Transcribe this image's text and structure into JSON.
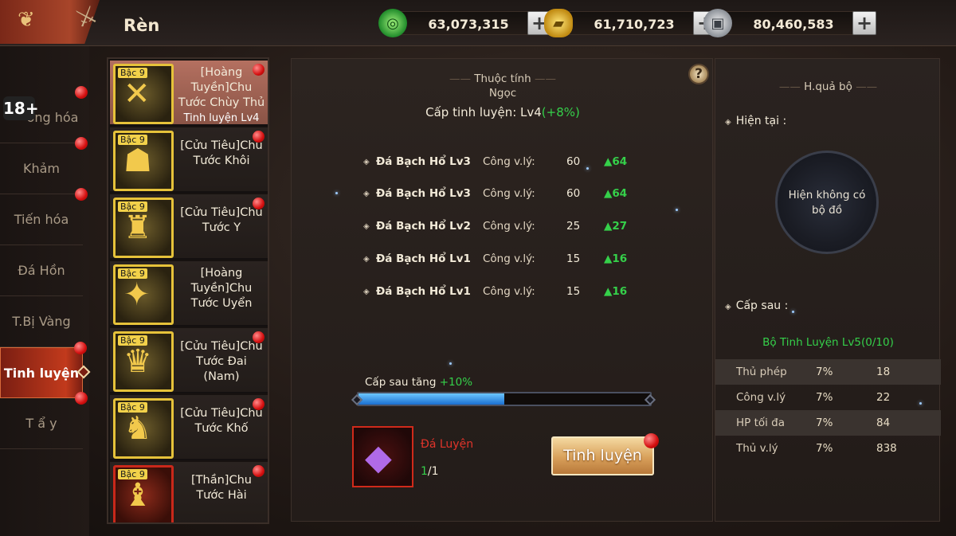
{
  "header": {
    "title": "Rèn",
    "currencies": [
      {
        "icon": "jade-coin-icon",
        "value": "63,073,315"
      },
      {
        "icon": "gold-ingot-icon",
        "value": "61,710,723"
      },
      {
        "icon": "silver-coin-icon",
        "value": "80,460,583"
      }
    ],
    "plus_label": "+"
  },
  "age_rating": "18+",
  "nav": {
    "items": [
      {
        "label": "Cường hóa",
        "badge": true
      },
      {
        "label": "Khảm",
        "badge": true
      },
      {
        "label": "Tiến hóa",
        "badge": true
      },
      {
        "label": "Đá Hồn",
        "badge": false
      },
      {
        "label": "T.Bị Vàng",
        "badge": false
      },
      {
        "label": "Tinh luyện",
        "badge": true,
        "active": true
      },
      {
        "label": "T ẩ y",
        "badge": true
      }
    ],
    "first_visible": "ờng hóa"
  },
  "items": [
    {
      "rank": "Bậc 9",
      "name": "[Hoàng Tuyền]Chu Tước Chùy Thủ",
      "sub": "Tinh luyện Lv4",
      "selected": true,
      "badge": true
    },
    {
      "rank": "Bậc 9",
      "name": "[Cửu Tiêu]Chu Tước Khôi",
      "sub": "",
      "badge": true
    },
    {
      "rank": "Bậc 9",
      "name": "[Cửu Tiêu]Chu Tước Y",
      "sub": "",
      "badge": true
    },
    {
      "rank": "Bậc 9",
      "name": "[Hoàng Tuyền]Chu Tước Uyển",
      "sub": "",
      "badge": false
    },
    {
      "rank": "Bậc 9",
      "name": "[Cửu Tiêu]Chu Tước Đai (Nam)",
      "sub": "",
      "badge": true
    },
    {
      "rank": "Bậc 9",
      "name": "[Cửu Tiêu]Chu Tước Khố",
      "sub": "",
      "badge": true
    },
    {
      "rank": "Bậc 9",
      "name": "[Thần]Chu Tước Hài",
      "sub": "",
      "badge": true
    }
  ],
  "center": {
    "help": "?",
    "attr_title_1": "Thuộc tính",
    "attr_title_2": "Ngọc",
    "refine_label": "Cấp tinh luyện: Lv4",
    "refine_bonus": "(+8%)",
    "stats": [
      {
        "gem": "Đá Bạch Hổ Lv3",
        "stat": "Công v.lý:",
        "value": "60",
        "up": "64"
      },
      {
        "gem": "Đá Bạch Hổ Lv3",
        "stat": "Công v.lý:",
        "value": "60",
        "up": "64"
      },
      {
        "gem": "Đá Bạch Hổ Lv2",
        "stat": "Công v.lý:",
        "value": "25",
        "up": "27"
      },
      {
        "gem": "Đá Bạch Hổ Lv1",
        "stat": "Công v.lý:",
        "value": "15",
        "up": "16"
      },
      {
        "gem": "Đá Bạch Hổ Lv1",
        "stat": "Công v.lý:",
        "value": "15",
        "up": "16"
      }
    ],
    "next_gain_label": "Cấp sau tăng",
    "next_gain_value": "+10%",
    "progress": 0.5,
    "material_name": "Đá Luyện",
    "material_have": "1",
    "material_need": "/1",
    "refine_button": "Tinh luyện"
  },
  "right": {
    "title": "H.quả bộ",
    "current_label": "Hiện tại :",
    "none_text_1": "Hiện không có",
    "none_text_2": "bộ đồ",
    "next_label": "Cấp sau :",
    "next_set": "Bộ Tinh Luyện Lv5(0/10)",
    "bonuses": [
      {
        "name": "Thủ phép",
        "pct": "7%",
        "value": "18"
      },
      {
        "name": "Công v.lý",
        "pct": "7%",
        "value": "22"
      },
      {
        "name": "HP tối đa",
        "pct": "7%",
        "value": "84"
      },
      {
        "name": "Thủ v.lý",
        "pct": "7%",
        "value": "838"
      }
    ]
  }
}
